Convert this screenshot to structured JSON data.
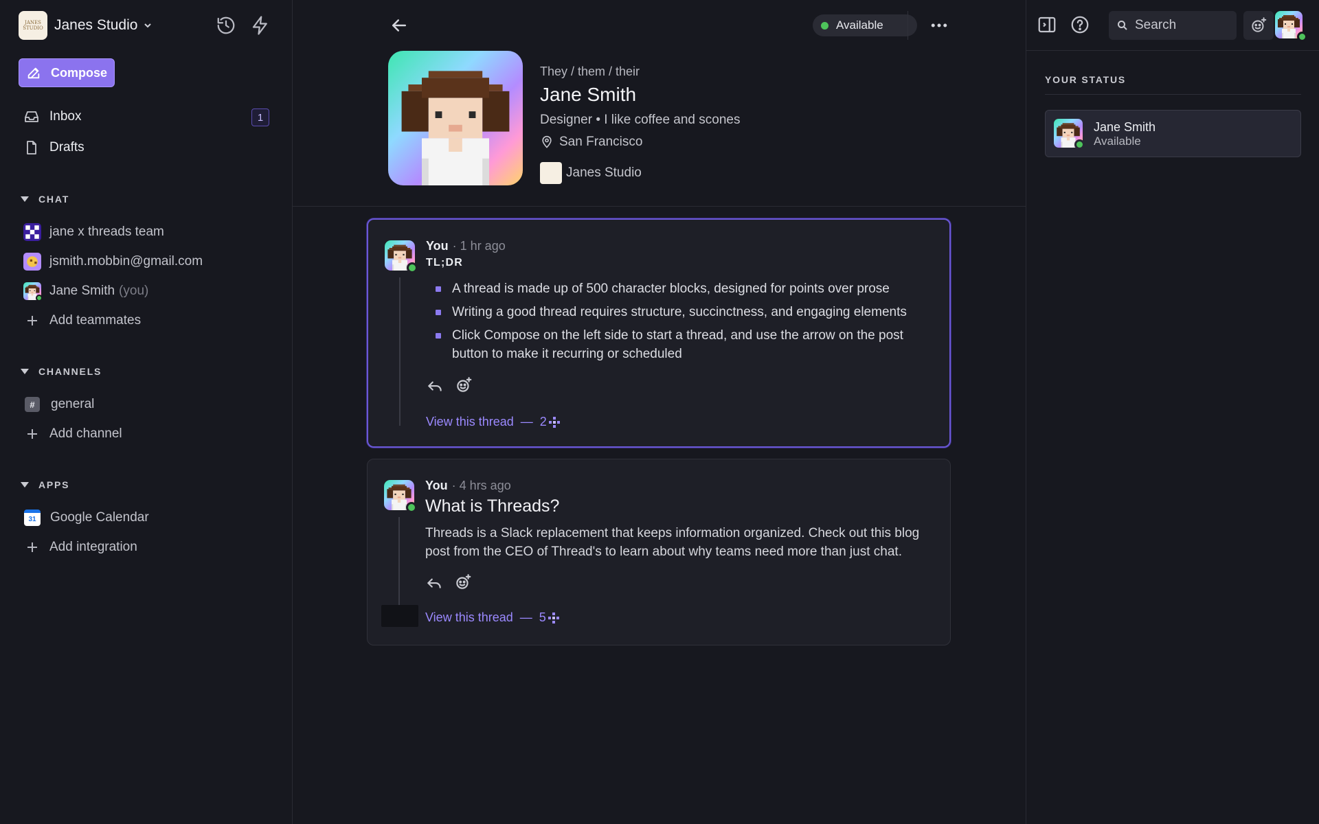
{
  "workspace": {
    "name": "Janes Studio",
    "logo_text": "JANES STUDIO"
  },
  "sidebar": {
    "compose_label": "Compose",
    "nav": [
      {
        "label": "Inbox",
        "badge": "1"
      },
      {
        "label": "Drafts"
      }
    ],
    "sections": {
      "chat": "CHAT",
      "channels": "CHANNELS",
      "apps": "APPS"
    },
    "chat_items": [
      {
        "label": "jane x threads team"
      },
      {
        "label": "jsmith.mobbin@gmail.com"
      },
      {
        "label": "Jane Smith",
        "suffix": "(you)"
      }
    ],
    "add_teammates": "Add teammates",
    "channel_items": [
      {
        "label": "general",
        "icon_text": "#"
      }
    ],
    "add_channel": "Add channel",
    "app_items": [
      {
        "label": "Google Calendar",
        "icon_text": "31"
      }
    ],
    "add_integration": "Add integration"
  },
  "main": {
    "status_label": "Available",
    "profile": {
      "pronouns": "They / them / their",
      "name": "Jane Smith",
      "bio": "Designer • I like coffee and scones",
      "location": "San Francisco",
      "workspace": "Janes Studio"
    },
    "threads": [
      {
        "author": "You",
        "time": "· 1 hr ago",
        "heading": "TL;DR",
        "bullets": [
          "A thread is made up of 500 character blocks, designed for points over prose",
          "Writing a good thread requires structure, succinctness, and engaging elements",
          "Click Compose on the left side to start a thread, and use the arrow on the post button to make it recurring or scheduled"
        ],
        "view_label": "View this thread",
        "dash": "—",
        "count": "2"
      },
      {
        "author": "You",
        "time": "· 4 hrs ago",
        "title": "What is Threads?",
        "body": "Threads is a Slack replacement that keeps information organized. Check out this blog post from the CEO of Thread's to learn about why teams need more than just chat.",
        "view_label": "View this thread",
        "dash": "—",
        "count": "5"
      }
    ]
  },
  "right_panel": {
    "search_label": "Search",
    "your_status_title": "YOUR STATUS",
    "status_card": {
      "name": "Jane Smith",
      "status": "Available"
    }
  },
  "colors": {
    "accent": "#8b73ee",
    "link": "#9b89ff",
    "online": "#4ec35b",
    "background": "#17181f",
    "card": "#1e1f27"
  }
}
